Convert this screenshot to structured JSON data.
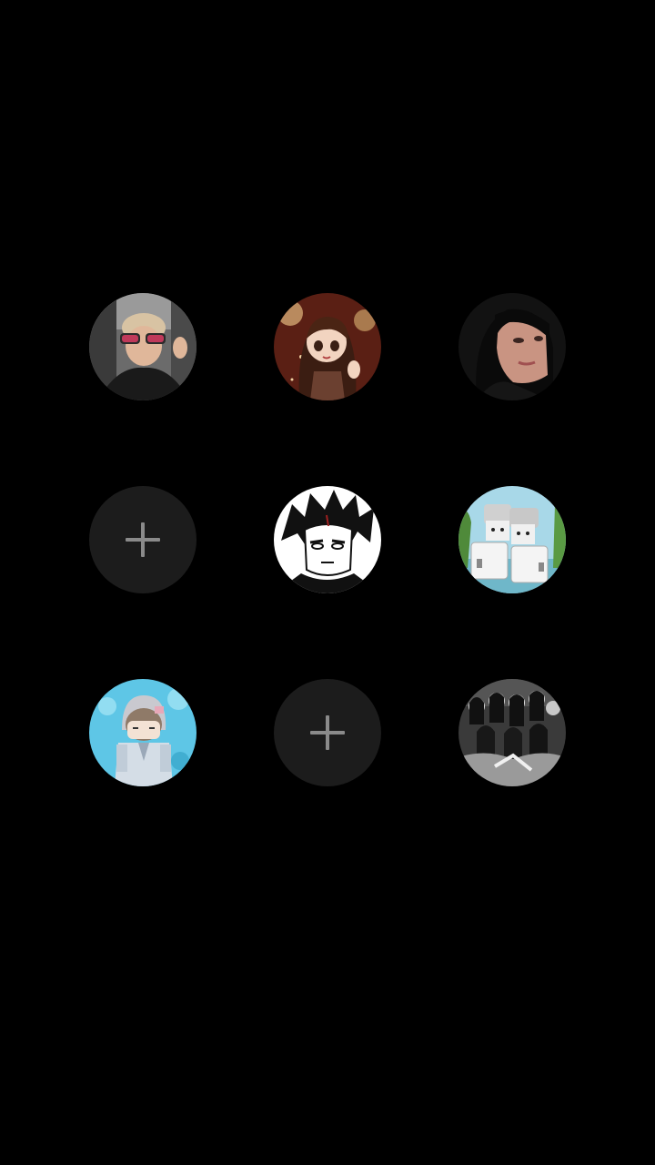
{
  "screen": {
    "background": "#000000"
  },
  "avatar_grid": {
    "slots": [
      {
        "type": "avatar",
        "icon": "profile-photo-boy-sunglasses"
      },
      {
        "type": "avatar",
        "icon": "profile-photo-anime-girl-brown"
      },
      {
        "type": "avatar",
        "icon": "profile-photo-woman-dark-hair"
      },
      {
        "type": "add",
        "icon": "plus-icon"
      },
      {
        "type": "avatar",
        "icon": "profile-photo-manga-character"
      },
      {
        "type": "avatar",
        "icon": "profile-photo-game-characters-beach"
      },
      {
        "type": "avatar",
        "icon": "profile-photo-game-character-blue"
      },
      {
        "type": "add",
        "icon": "plus-icon"
      },
      {
        "type": "avatar",
        "icon": "profile-photo-group-grayscale"
      }
    ],
    "add_slot_color": "#1c1c1c",
    "plus_color": "#8a8a8a"
  }
}
